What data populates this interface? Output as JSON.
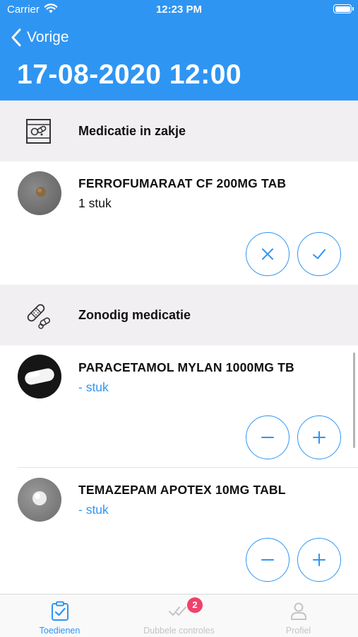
{
  "status_bar": {
    "carrier": "Carrier",
    "time": "12:23 PM"
  },
  "nav": {
    "back_label": "Vorige",
    "title": "17-08-2020 12:00"
  },
  "sections": [
    {
      "label": "Medicatie in zakje",
      "icon": "medication-bag-icon",
      "items": [
        {
          "name": "FERROFUMARAAT CF 200MG TAB",
          "quantity": "1 stuk"
        }
      ]
    },
    {
      "label": "Zonodig medicatie",
      "icon": "bandage-pills-icon",
      "items": [
        {
          "name": "PARACETAMOL MYLAN 1000MG TB",
          "quantity": "- stuk"
        },
        {
          "name": "TEMAZEPAM APOTEX 10MG TABL",
          "quantity": "- stuk"
        }
      ]
    }
  ],
  "tabs": [
    {
      "label": "Toedienen",
      "icon": "clipboard-check-icon",
      "active": true
    },
    {
      "label": "Dubbele controles",
      "icon": "double-check-icon",
      "badge": "2",
      "active": false
    },
    {
      "label": "Profiel",
      "icon": "person-icon",
      "active": false
    }
  ],
  "colors": {
    "primary": "#2f95f3",
    "section_bg": "#f1eff2",
    "badge": "#f0416a",
    "inactive_tab": "#bdbdbd"
  }
}
